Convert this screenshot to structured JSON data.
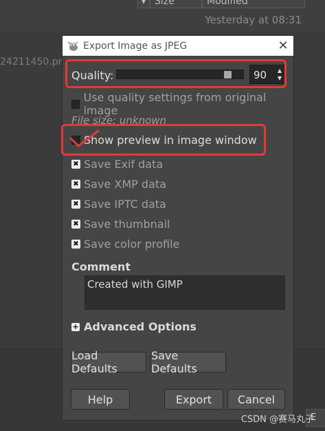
{
  "background": {
    "size_col": "Size",
    "modified_col": "Modified",
    "modified_value": "Yesterday at 08:31",
    "file_fragment": "24211450.pr",
    "corner_button": "E"
  },
  "dialog": {
    "title": "Export Image as JPEG",
    "quality_label": "Quality:",
    "quality_value": "90",
    "quality_level": 0.9,
    "use_original_label": "Use quality settings from original image",
    "file_size_label": "File size: unknown",
    "show_preview_label": "Show preview in image window",
    "checkboxes": [
      {
        "label": "Save Exif data",
        "checked": true
      },
      {
        "label": "Save XMP data",
        "checked": true
      },
      {
        "label": "Save IPTC data",
        "checked": true
      },
      {
        "label": "Save thumbnail",
        "checked": true
      },
      {
        "label": "Save color profile",
        "checked": true
      }
    ],
    "comment_heading": "Comment",
    "comment_text": "Created with GIMP",
    "advanced_label": "Advanced Options",
    "load_defaults": "Load Defaults",
    "save_defaults": "Save Defaults",
    "help": "Help",
    "export": "Export",
    "cancel": "Cancel"
  },
  "watermark": "CSDN @赛马丸子",
  "annotation_color": "#e53935"
}
